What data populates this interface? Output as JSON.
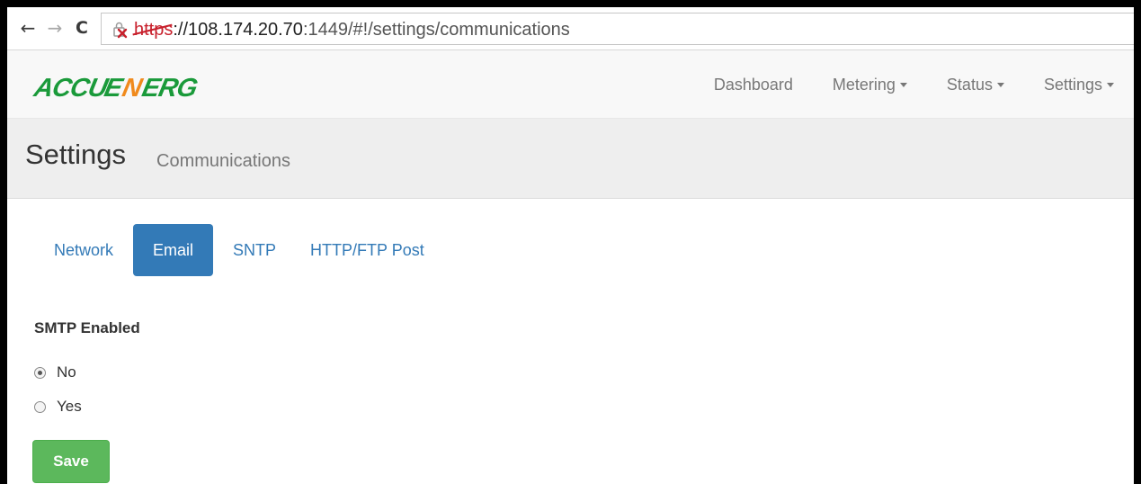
{
  "browser": {
    "back_glyph": "←",
    "forward_glyph": "→",
    "reload_glyph": "C",
    "url": {
      "scheme": "https",
      "rest_after_scheme": "://",
      "host": "108.174.20.70",
      "path": ":1449/#!/settings/communications"
    },
    "icons": {
      "back": "back-arrow-icon",
      "forward": "forward-arrow-icon",
      "reload": "reload-icon",
      "security": "insecure-lock-icon"
    }
  },
  "navbar": {
    "brand": "ACCUENERGY",
    "links": [
      {
        "label": "Dashboard",
        "dropdown": false
      },
      {
        "label": "Metering",
        "dropdown": true
      },
      {
        "label": "Status",
        "dropdown": true
      },
      {
        "label": "Settings",
        "dropdown": true
      }
    ]
  },
  "header": {
    "title": "Settings",
    "subtitle": "Communications"
  },
  "tabs": [
    {
      "label": "Network",
      "active": false
    },
    {
      "label": "Email",
      "active": true
    },
    {
      "label": "SNTP",
      "active": false
    },
    {
      "label": "HTTP/FTP Post",
      "active": false
    }
  ],
  "form": {
    "field_label": "SMTP Enabled",
    "options": [
      {
        "label": "No",
        "checked": true
      },
      {
        "label": "Yes",
        "checked": false
      }
    ],
    "save_label": "Save"
  },
  "colors": {
    "primary": "#337ab7",
    "success": "#5cb85c",
    "logo_green": "#1a9a3a",
    "logo_orange": "#f08a1c",
    "insecure_red": "#c8202c"
  }
}
